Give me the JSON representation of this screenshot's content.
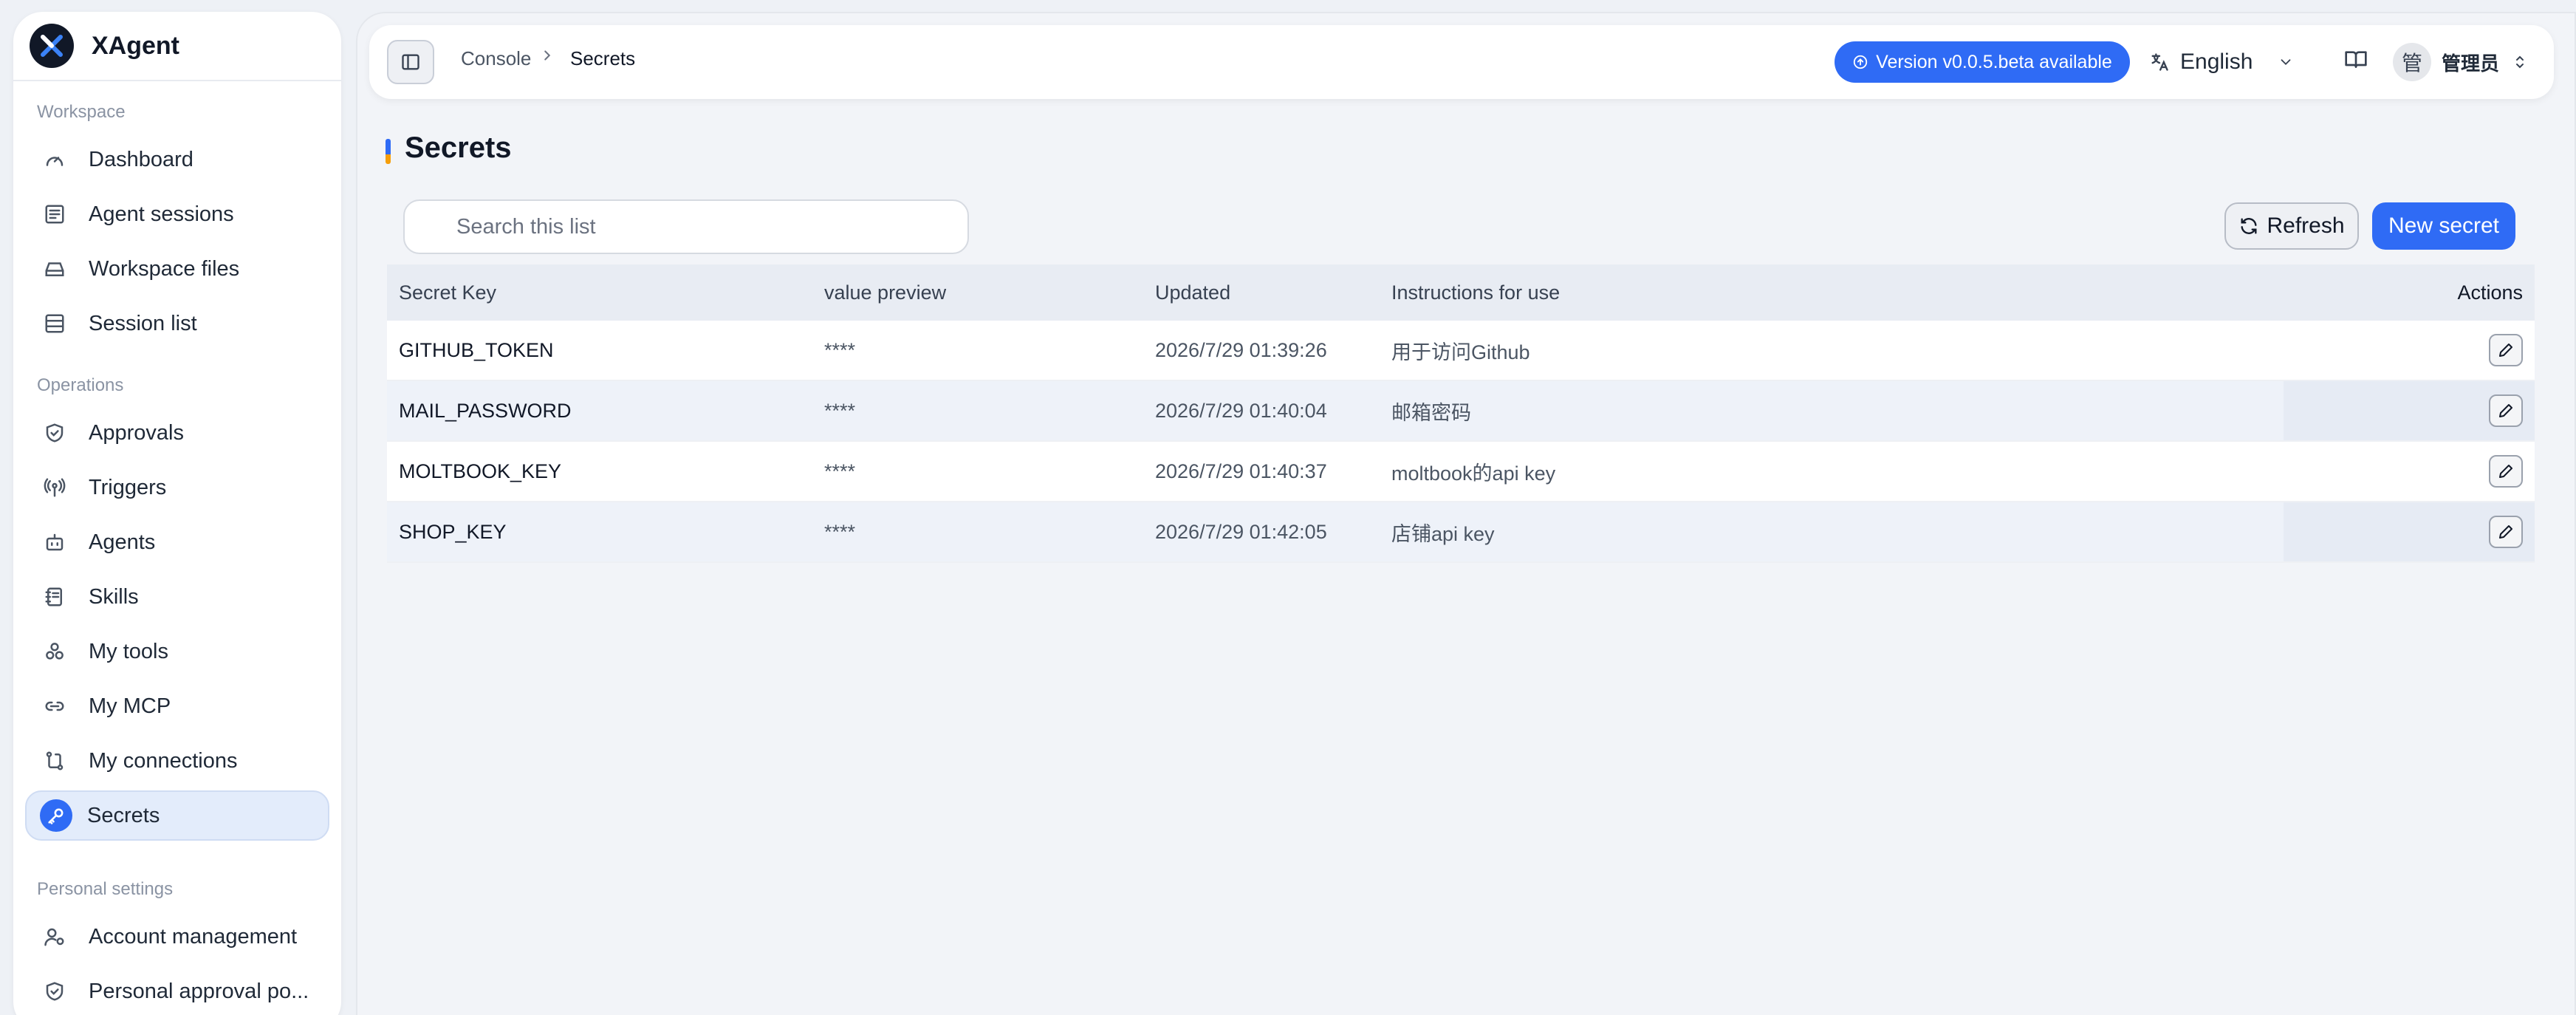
{
  "app": {
    "name": "XAgent"
  },
  "sidebar": {
    "sections": [
      {
        "label": "Workspace"
      },
      {
        "label": "Operations"
      },
      {
        "label": "Personal settings"
      }
    ],
    "items": [
      {
        "label": "Dashboard",
        "icon": "gauge-icon"
      },
      {
        "label": "Agent sessions",
        "icon": "message-list-icon"
      },
      {
        "label": "Workspace files",
        "icon": "drive-icon"
      },
      {
        "label": "Session list",
        "icon": "list-icon"
      },
      {
        "label": "Approvals",
        "icon": "shield-check-icon"
      },
      {
        "label": "Triggers",
        "icon": "radio-tower-icon"
      },
      {
        "label": "Agents",
        "icon": "robot-icon"
      },
      {
        "label": "Skills",
        "icon": "notebook-icon"
      },
      {
        "label": "My tools",
        "icon": "blocks-icon"
      },
      {
        "label": "My MCP",
        "icon": "link-icon"
      },
      {
        "label": "My connections",
        "icon": "connections-icon"
      },
      {
        "label": "Secrets",
        "icon": "key-icon",
        "active": true
      },
      {
        "label": "Account management",
        "icon": "user-gear-icon"
      },
      {
        "label": "Personal approval po...",
        "icon": "shield-check-icon"
      }
    ]
  },
  "header": {
    "breadcrumb": [
      "Console",
      "Secrets"
    ],
    "version_badge": "Version v0.0.5.beta available",
    "language": "English",
    "user_avatar": "管",
    "user_name": "管理员"
  },
  "page": {
    "title": "Secrets",
    "search_placeholder": "Search this list",
    "refresh_label": "Refresh",
    "new_label": "New secret"
  },
  "table": {
    "columns": [
      "Secret Key",
      "value preview",
      "Updated",
      "Instructions for use",
      "Actions"
    ],
    "rows": [
      {
        "key": "GITHUB_TOKEN",
        "preview": "****",
        "updated": "2026/7/29 01:39:26",
        "instructions": "用于访问Github"
      },
      {
        "key": "MAIL_PASSWORD",
        "preview": "****",
        "updated": "2026/7/29 01:40:04",
        "instructions": "邮箱密码"
      },
      {
        "key": "MOLTBOOK_KEY",
        "preview": "****",
        "updated": "2026/7/29 01:40:37",
        "instructions": "moltbook的api key"
      },
      {
        "key": "SHOP_KEY",
        "preview": "****",
        "updated": "2026/7/29 01:42:05",
        "instructions": "店铺api key"
      }
    ]
  },
  "colors": {
    "accent": "#2f6bf5",
    "active_bg": "#e3ecfb",
    "page_bg": "#eef1f6"
  }
}
